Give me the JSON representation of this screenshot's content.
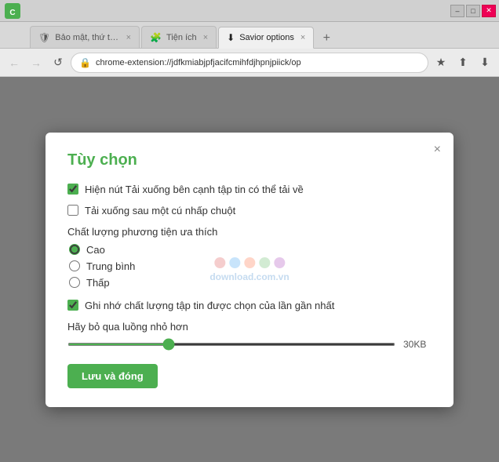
{
  "browser": {
    "title_buttons": {
      "minimize": "–",
      "maximize": "□",
      "close": "✕"
    },
    "tabs": [
      {
        "id": "tab-1",
        "label": "Bảo mật, thứ th...",
        "favicon": "shield",
        "active": false
      },
      {
        "id": "tab-2",
        "label": "Tiện ích",
        "favicon": "puzzle",
        "active": false
      },
      {
        "id": "tab-3",
        "label": "Savior options",
        "favicon": "down",
        "active": true
      }
    ],
    "address": "chrome-extension://jdfkmiabjpfjacifcmihfdjhpnjpiick/op",
    "nav": {
      "back": "←",
      "forward": "→",
      "refresh": "↺"
    }
  },
  "dialog": {
    "title": "Tùy chọn",
    "close_label": "×",
    "watermark": "download.com.vn",
    "checkbox1": {
      "label": "Hiện nút Tải xuống bên cạnh tập tin có thể tải về",
      "checked": true
    },
    "checkbox2": {
      "label": "Tải xuống sau một cú nhấp chuột",
      "checked": false
    },
    "quality_label": "Chất lượng phương tiện ưa thích",
    "quality_options": [
      {
        "value": "cao",
        "label": "Cao",
        "selected": true
      },
      {
        "value": "trung_binh",
        "label": "Trung bình",
        "selected": false
      },
      {
        "value": "thap",
        "label": "Thấp",
        "selected": false
      }
    ],
    "checkbox3": {
      "label": "Ghi nhớ chất lượng tập tin được chọn của lần gần nhất",
      "checked": true
    },
    "slider": {
      "label": "Hãy bỏ qua luồng nhỏ hơn",
      "value": 30,
      "unit": "KB",
      "min": 0,
      "max": 100
    },
    "save_button": "Lưu và đóng",
    "watermark_dots": [
      {
        "color": "#e57373"
      },
      {
        "color": "#64b5f6"
      },
      {
        "color": "#ff8a65"
      },
      {
        "color": "#81c784"
      },
      {
        "color": "#ba68c8"
      }
    ]
  }
}
